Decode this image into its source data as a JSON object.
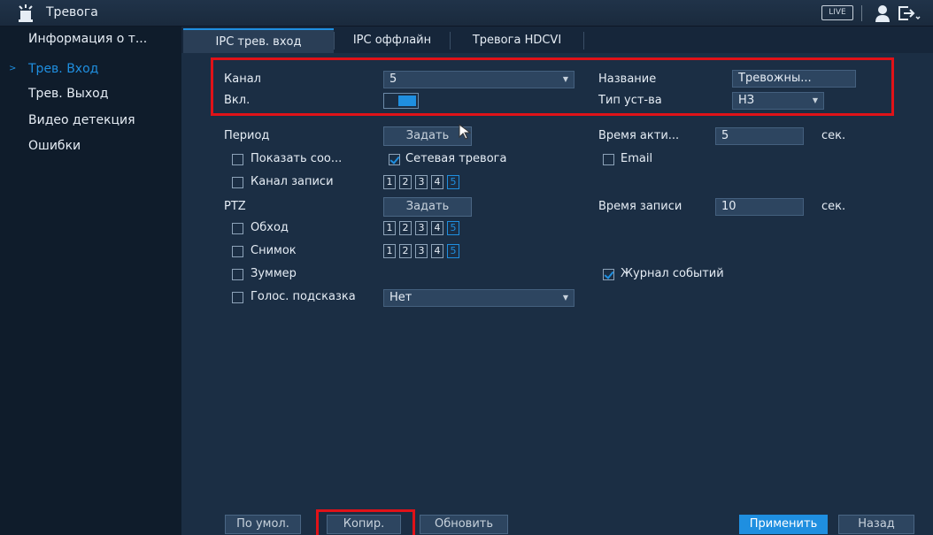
{
  "window": {
    "title": "Тревога",
    "live_label": "LIVE"
  },
  "sidebar": {
    "items": [
      {
        "label": "Информация о т..."
      },
      {
        "label": "Трев. Вход"
      },
      {
        "label": "Трев. Выход"
      },
      {
        "label": "Видео детекция"
      },
      {
        "label": "Ошибки"
      }
    ],
    "active_index": 1
  },
  "tabs": [
    {
      "label": "IPC трев. вход"
    },
    {
      "label": "IPC оффлайн"
    },
    {
      "label": "Тревога HDCVI"
    }
  ],
  "form": {
    "channel_label": "Канал",
    "channel_value": "5",
    "name_label": "Название",
    "name_value": "Тревожны...",
    "enable_label": "Вкл.",
    "enable_on": true,
    "device_type_label": "Тип уст-ва",
    "device_type_value": "НЗ",
    "period_label": "Период",
    "period_button": "Задать",
    "active_time_label": "Время акти...",
    "active_time_value": "5",
    "active_time_unit": "сек.",
    "show_message_label": "Показать соо...",
    "show_message_checked": false,
    "net_alarm_label": "Сетевая тревога",
    "net_alarm_checked": true,
    "email_label": "Email",
    "email_checked": false,
    "record_channel_label": "Канал записи",
    "record_channel_checked": false,
    "ptz_label": "PTZ",
    "ptz_button": "Задать",
    "record_time_label": "Время записи",
    "record_time_value": "10",
    "record_time_unit": "сек.",
    "tour_label": "Обход",
    "tour_checked": false,
    "snapshot_label": "Снимок",
    "snapshot_checked": false,
    "buzzer_label": "Зуммер",
    "buzzer_checked": false,
    "event_log_label": "Журнал событий",
    "event_log_checked": true,
    "voice_prompt_label": "Голос. подсказка",
    "voice_prompt_checked": false,
    "voice_prompt_value": "Нет",
    "channels": [
      "1",
      "2",
      "3",
      "4",
      "5"
    ],
    "selected_channel": "5"
  },
  "footer": {
    "default_button": "По умол.",
    "copy_button": "Копир.",
    "refresh_button": "Обновить",
    "apply_button": "Применить",
    "back_button": "Назад"
  },
  "colors": {
    "accent": "#1f8fe0",
    "highlight": "#e01218",
    "background": "#1b2e44"
  },
  "icons": [
    "alarm-icon",
    "user-icon",
    "logout-icon",
    "dropdown-arrow-icon",
    "cursor-icon"
  ]
}
